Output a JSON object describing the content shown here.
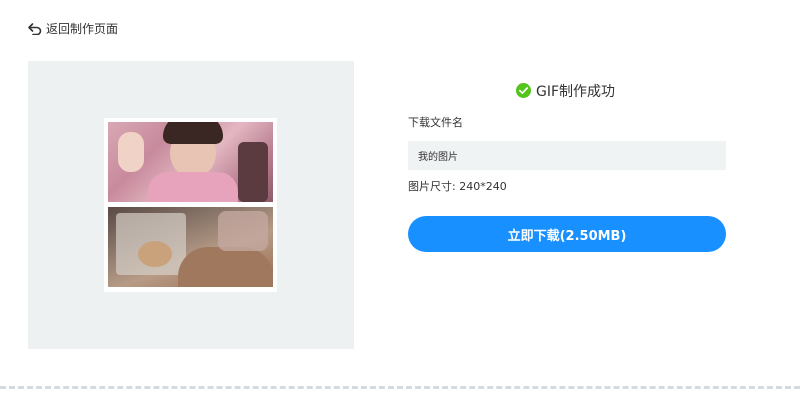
{
  "header": {
    "back_label": "返回制作页面",
    "back_icon": "undo-arrow-icon"
  },
  "preview": {
    "tiles": [
      "gif-frame-top",
      "gif-frame-bottom"
    ]
  },
  "result": {
    "success_icon": "check-circle-icon",
    "success_text": "GIF制作成功",
    "filename_label": "下载文件名",
    "filename_value": "我的图片",
    "size_info": "图片尺寸: 240*240",
    "download_label": "立即下载(2.50MB)"
  },
  "colors": {
    "accent": "#1890ff",
    "success": "#52c41a",
    "panel_bg": "#eef1f2",
    "input_bg": "#f0f3f4",
    "divider": "#d3dbe1"
  }
}
